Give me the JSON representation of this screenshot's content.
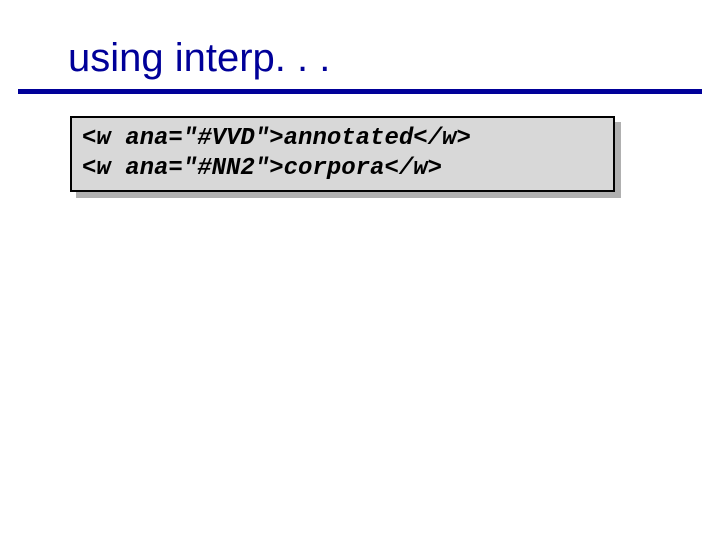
{
  "title": "using interp. . .",
  "code": {
    "line1": "<w ana=\"#VVD\">annotated</w>",
    "line2": "<w ana=\"#NN2\">corpora</w>"
  }
}
